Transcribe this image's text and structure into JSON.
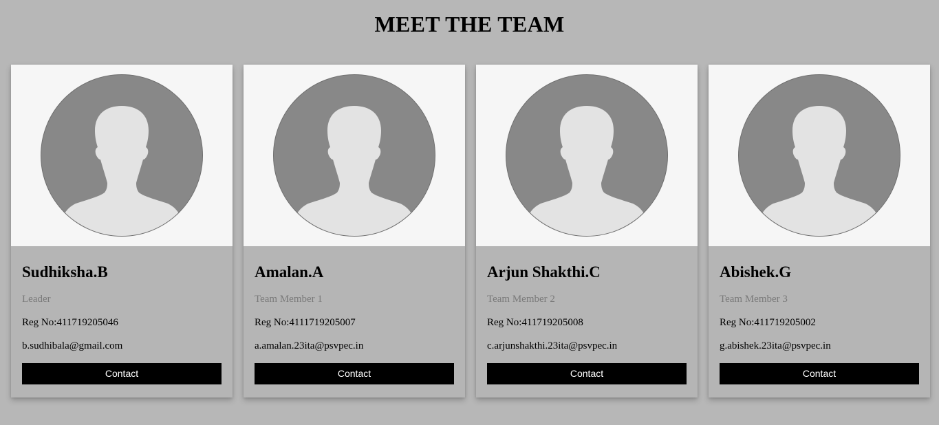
{
  "page": {
    "title": "MEET THE TEAM"
  },
  "members": [
    {
      "name": "Sudhiksha.B",
      "role": "Leader",
      "reg": "Reg No:411719205046",
      "email": "b.sudhibala@gmail.com",
      "button_label": "Contact"
    },
    {
      "name": "Amalan.A",
      "role": "Team Member 1",
      "reg": "Reg No:4111719205007",
      "email": "a.amalan.23ita@psvpec.in",
      "button_label": "Contact"
    },
    {
      "name": "Arjun Shakthi.C",
      "role": "Team Member 2",
      "reg": "Reg No:411719205008",
      "email": "c.arjunshakthi.23ita@psvpec.in",
      "button_label": "Contact"
    },
    {
      "name": "Abishek.G",
      "role": "Team Member 3",
      "reg": "Reg No:411719205002",
      "email": "g.abishek.23ita@psvpec.in",
      "button_label": "Contact"
    }
  ],
  "icons": {
    "avatar": "default-user-avatar-icon"
  },
  "colors": {
    "page_background": "#b7b7b7",
    "photo_background": "#f6f6f6",
    "avatar_circle": "#888888",
    "avatar_silhouette": "#e3e3e3",
    "role_text": "#7a7a7a",
    "button_background": "#000000",
    "button_text": "#ffffff"
  }
}
